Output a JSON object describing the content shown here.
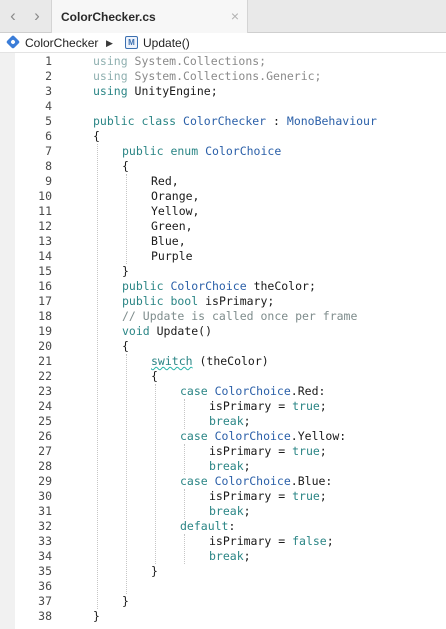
{
  "tabbar": {
    "back_icon": "chevron-left-icon",
    "forward_icon": "chevron-right-icon",
    "tab_title": "ColorChecker.cs",
    "close_glyph": "×"
  },
  "pathbar": {
    "class_icon": "class-icon",
    "class_label": "ColorChecker",
    "separator": "▶",
    "method_icon_text": "M",
    "method_label": "Update()"
  },
  "editor": {
    "lines": [
      {
        "n": "1",
        "indent": 0,
        "tokens": [
          [
            "kwgray",
            "using "
          ],
          [
            "usingdim",
            "System.Collections;"
          ]
        ]
      },
      {
        "n": "2",
        "indent": 0,
        "tokens": [
          [
            "kwgray",
            "using "
          ],
          [
            "usingdim",
            "System.Collections.Generic;"
          ]
        ]
      },
      {
        "n": "3",
        "indent": 0,
        "tokens": [
          [
            "kw",
            "using "
          ],
          [
            "plain",
            "UnityEngine;"
          ]
        ]
      },
      {
        "n": "4",
        "indent": 0,
        "tokens": []
      },
      {
        "n": "5",
        "indent": 0,
        "tokens": [
          [
            "kw",
            "public class "
          ],
          [
            "type",
            "ColorChecker"
          ],
          [
            "plain",
            " : "
          ],
          [
            "type",
            "MonoBehaviour"
          ]
        ]
      },
      {
        "n": "6",
        "indent": 0,
        "tokens": [
          [
            "plain",
            "{"
          ]
        ]
      },
      {
        "n": "7",
        "indent": 1,
        "tokens": [
          [
            "kw",
            "public enum "
          ],
          [
            "type",
            "ColorChoice"
          ]
        ]
      },
      {
        "n": "8",
        "indent": 1,
        "tokens": [
          [
            "plain",
            "{"
          ]
        ]
      },
      {
        "n": "9",
        "indent": 2,
        "tokens": [
          [
            "plain",
            "Red,"
          ]
        ]
      },
      {
        "n": "10",
        "indent": 2,
        "tokens": [
          [
            "plain",
            "Orange,"
          ]
        ]
      },
      {
        "n": "11",
        "indent": 2,
        "tokens": [
          [
            "plain",
            "Yellow,"
          ]
        ]
      },
      {
        "n": "12",
        "indent": 2,
        "tokens": [
          [
            "plain",
            "Green,"
          ]
        ]
      },
      {
        "n": "13",
        "indent": 2,
        "tokens": [
          [
            "plain",
            "Blue,"
          ]
        ]
      },
      {
        "n": "14",
        "indent": 2,
        "tokens": [
          [
            "plain",
            "Purple"
          ]
        ]
      },
      {
        "n": "15",
        "indent": 1,
        "tokens": [
          [
            "plain",
            "}"
          ]
        ]
      },
      {
        "n": "16",
        "indent": 1,
        "tokens": [
          [
            "kw",
            "public "
          ],
          [
            "type",
            "ColorChoice"
          ],
          [
            "plain",
            " theColor;"
          ]
        ]
      },
      {
        "n": "17",
        "indent": 1,
        "tokens": [
          [
            "kw",
            "public bool "
          ],
          [
            "plain",
            "isPrimary;"
          ]
        ]
      },
      {
        "n": "18",
        "indent": 1,
        "tokens": [
          [
            "cmt",
            "// Update is called once per frame"
          ]
        ]
      },
      {
        "n": "19",
        "indent": 1,
        "tokens": [
          [
            "kw",
            "void "
          ],
          [
            "plain",
            "Update()"
          ]
        ]
      },
      {
        "n": "20",
        "indent": 1,
        "tokens": [
          [
            "plain",
            "{"
          ]
        ]
      },
      {
        "n": "21",
        "indent": 2,
        "tokens": [
          [
            "kwsquig",
            "switch"
          ],
          [
            "plain",
            " (theColor)"
          ]
        ]
      },
      {
        "n": "22",
        "indent": 2,
        "tokens": [
          [
            "plain",
            "{"
          ]
        ]
      },
      {
        "n": "23",
        "indent": 3,
        "tokens": [
          [
            "kw",
            "case "
          ],
          [
            "type",
            "ColorChoice"
          ],
          [
            "plain",
            ".Red:"
          ]
        ]
      },
      {
        "n": "24",
        "indent": 4,
        "tokens": [
          [
            "plain",
            "isPrimary = "
          ],
          [
            "kw",
            "true"
          ],
          [
            "plain",
            ";"
          ]
        ]
      },
      {
        "n": "25",
        "indent": 4,
        "tokens": [
          [
            "kw",
            "break"
          ],
          [
            "plain",
            ";"
          ]
        ]
      },
      {
        "n": "26",
        "indent": 3,
        "tokens": [
          [
            "kw",
            "case "
          ],
          [
            "type",
            "ColorChoice"
          ],
          [
            "plain",
            ".Yellow:"
          ]
        ]
      },
      {
        "n": "27",
        "indent": 4,
        "tokens": [
          [
            "plain",
            "isPrimary = "
          ],
          [
            "kw",
            "true"
          ],
          [
            "plain",
            ";"
          ]
        ]
      },
      {
        "n": "28",
        "indent": 4,
        "tokens": [
          [
            "kw",
            "break"
          ],
          [
            "plain",
            ";"
          ]
        ]
      },
      {
        "n": "29",
        "indent": 3,
        "tokens": [
          [
            "kw",
            "case "
          ],
          [
            "type",
            "ColorChoice"
          ],
          [
            "plain",
            ".Blue:"
          ]
        ]
      },
      {
        "n": "30",
        "indent": 4,
        "tokens": [
          [
            "plain",
            "isPrimary = "
          ],
          [
            "kw",
            "true"
          ],
          [
            "plain",
            ";"
          ]
        ]
      },
      {
        "n": "31",
        "indent": 4,
        "tokens": [
          [
            "kw",
            "break"
          ],
          [
            "plain",
            ";"
          ]
        ]
      },
      {
        "n": "32",
        "indent": 3,
        "tokens": [
          [
            "kw",
            "default"
          ],
          [
            "plain",
            ":"
          ]
        ]
      },
      {
        "n": "33",
        "indent": 4,
        "tokens": [
          [
            "plain",
            "isPrimary = "
          ],
          [
            "kw",
            "false"
          ],
          [
            "plain",
            ";"
          ]
        ]
      },
      {
        "n": "34",
        "indent": 4,
        "tokens": [
          [
            "kw",
            "break"
          ],
          [
            "plain",
            ";"
          ]
        ]
      },
      {
        "n": "35",
        "indent": 2,
        "tokens": [
          [
            "plain",
            "}"
          ]
        ]
      },
      {
        "n": "36",
        "indent": 0,
        "tokens": []
      },
      {
        "n": "37",
        "indent": 1,
        "tokens": [
          [
            "plain",
            "}"
          ]
        ]
      },
      {
        "n": "38",
        "indent": 0,
        "tokens": [
          [
            "plain",
            "}"
          ]
        ]
      }
    ]
  },
  "colors": {
    "keyword": "#2a8585",
    "type": "#2a5fa8",
    "comment": "#7e8c8c",
    "squiggle": "#27b3a8"
  }
}
